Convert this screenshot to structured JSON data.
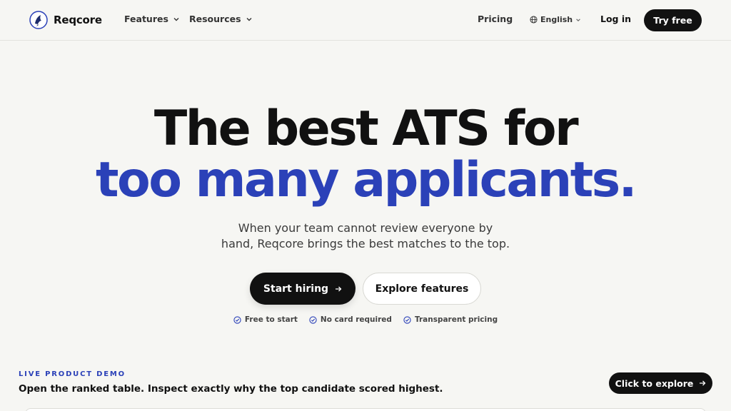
{
  "brand": {
    "name": "Reqcore"
  },
  "nav": {
    "features_label": "Features",
    "resources_label": "Resources",
    "pricing_label": "Pricing",
    "language_label": "English",
    "login_label": "Log in",
    "try_free_label": "Try free"
  },
  "hero": {
    "headline_line1": "The best ATS for",
    "headline_line2": "too many applicants.",
    "subtitle_line1": "When your team cannot review everyone by",
    "subtitle_line2": "hand, Reqcore brings the best matches to the top.",
    "primary_cta": "Start hiring",
    "secondary_cta": "Explore features",
    "perks": [
      "Free to start",
      "No card required",
      "Transparent pricing"
    ]
  },
  "demo": {
    "eyebrow": "LIVE PRODUCT DEMO",
    "description": "Open the ranked table. Inspect exactly why the top candidate scored highest.",
    "cta": "Click to explore"
  },
  "colors": {
    "accent": "#2b41b8",
    "dark": "#111111",
    "background": "#f6f6f3"
  },
  "icons": [
    "logo-bird-icon",
    "chevron-down-icon",
    "globe-icon",
    "arrow-right-icon",
    "check-circle-icon"
  ]
}
